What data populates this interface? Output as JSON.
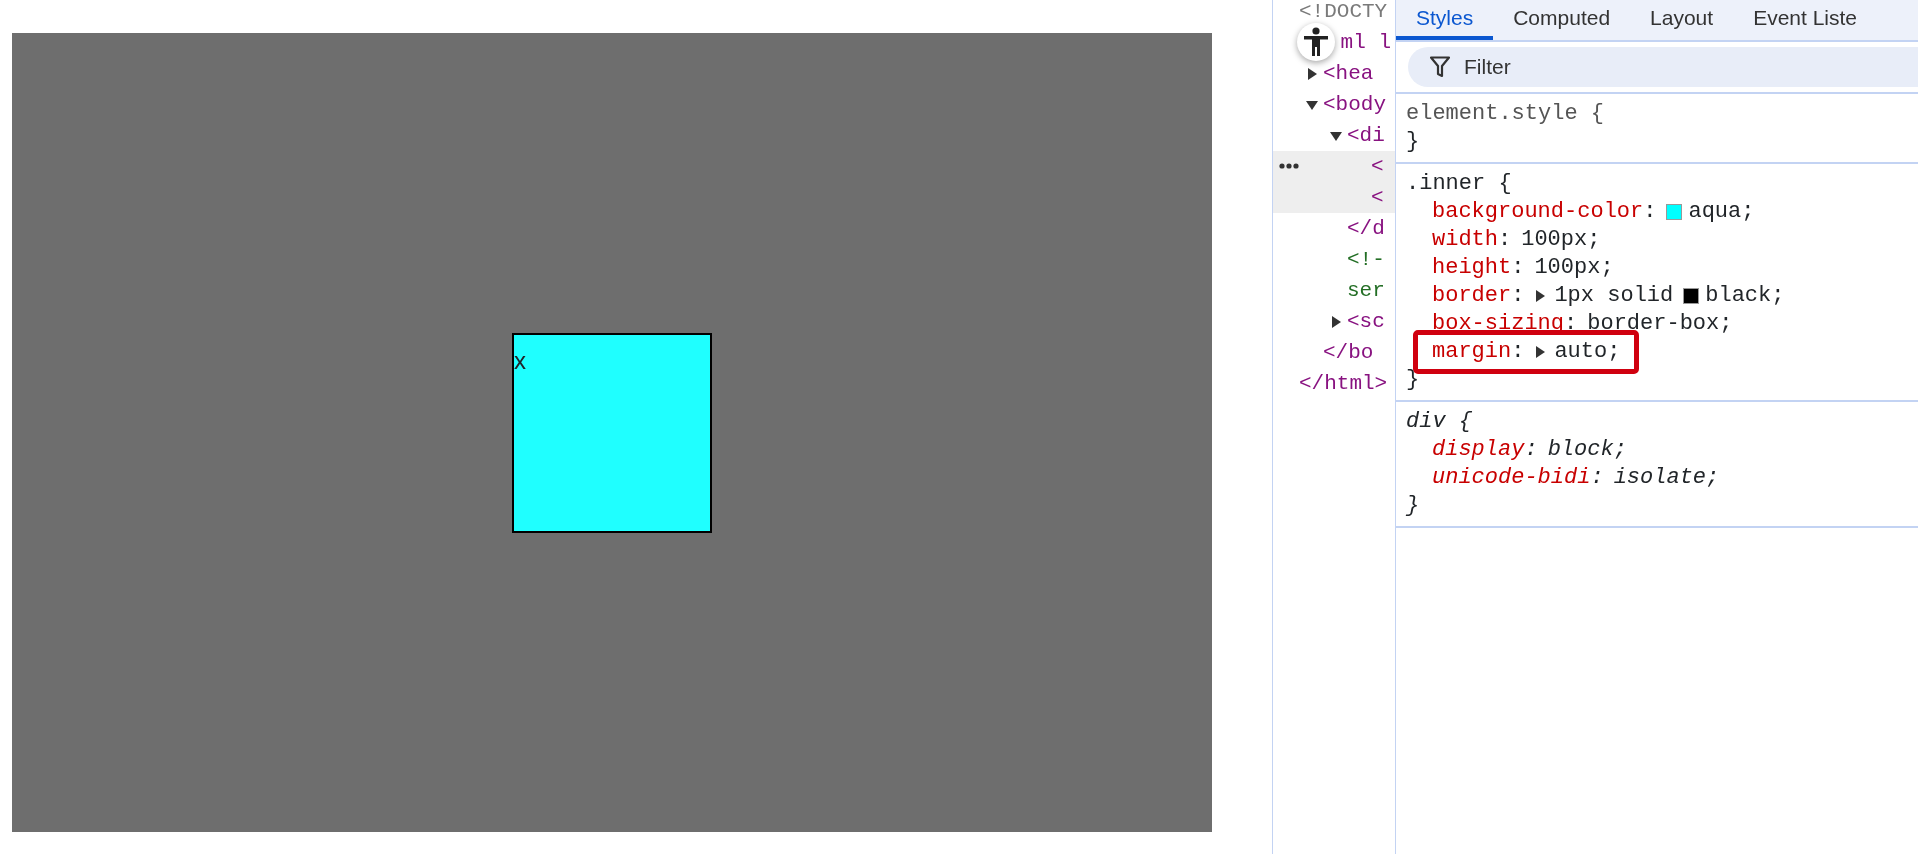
{
  "page": {
    "box_text": "x"
  },
  "elements_panel": {
    "nodes": [
      {
        "kind": "doctype",
        "text": "<!DOCTY",
        "selected": false
      },
      {
        "kind": "tag",
        "text": "ml l",
        "selected": false,
        "close": "</html>",
        "children": [
          {
            "kind": "tag",
            "text": "<hea",
            "expanded": false,
            "selected": false
          },
          {
            "kind": "tag",
            "text": "<body",
            "expanded": true,
            "selected": false,
            "close": "</bo",
            "children": [
              {
                "kind": "tag",
                "text": "<di",
                "expanded": true,
                "selected": false,
                "close": "</d",
                "children": [
                  {
                    "kind": "tag",
                    "text": "<",
                    "wrap": "<",
                    "selected": true
                  }
                ]
              },
              {
                "kind": "comment",
                "text": "<!-",
                "wrap": "ser",
                "selected": false
              },
              {
                "kind": "tag",
                "text": "<sc",
                "expanded": false,
                "selected": false
              }
            ]
          }
        ]
      }
    ]
  },
  "styles_panel": {
    "tabs": [
      {
        "label": "Styles",
        "selected": true
      },
      {
        "label": "Computed",
        "selected": false
      },
      {
        "label": "Layout",
        "selected": false
      },
      {
        "label": "Event Liste",
        "selected": false
      }
    ],
    "filter": {
      "placeholder": "Filter"
    },
    "rules": [
      {
        "kind": "inline",
        "selector": "element.style {",
        "close": "}"
      },
      {
        "kind": "author",
        "selector": ".inner {",
        "close": "}",
        "declarations": [
          {
            "property": "background-color",
            "colon": ":",
            "value": "aqua;",
            "color": "#00ffff",
            "expandable": false,
            "highlighted": false
          },
          {
            "property": "width",
            "colon": ":",
            "value": "100px;",
            "expandable": false,
            "highlighted": false
          },
          {
            "property": "height",
            "colon": ":",
            "value": "100px;",
            "expandable": false,
            "highlighted": false
          },
          {
            "property": "border",
            "colon": ":",
            "value": "1px solid",
            "color": "#000000",
            "value_after": "black;",
            "expandable": true,
            "highlighted": false
          },
          {
            "property": "box-sizing",
            "colon": ":",
            "value": "border-box;",
            "expandable": false,
            "highlighted": false
          },
          {
            "property": "margin",
            "colon": ":",
            "value": "auto;",
            "expandable": true,
            "highlighted": true
          }
        ]
      },
      {
        "kind": "user-agent",
        "selector": "div {",
        "close": "}",
        "declarations": [
          {
            "property": "display",
            "colon": ":",
            "value": "block;",
            "expandable": false,
            "highlighted": false
          },
          {
            "property": "unicode-bidi",
            "colon": ":",
            "value": "isolate;",
            "expandable": false,
            "highlighted": false
          }
        ]
      }
    ]
  }
}
